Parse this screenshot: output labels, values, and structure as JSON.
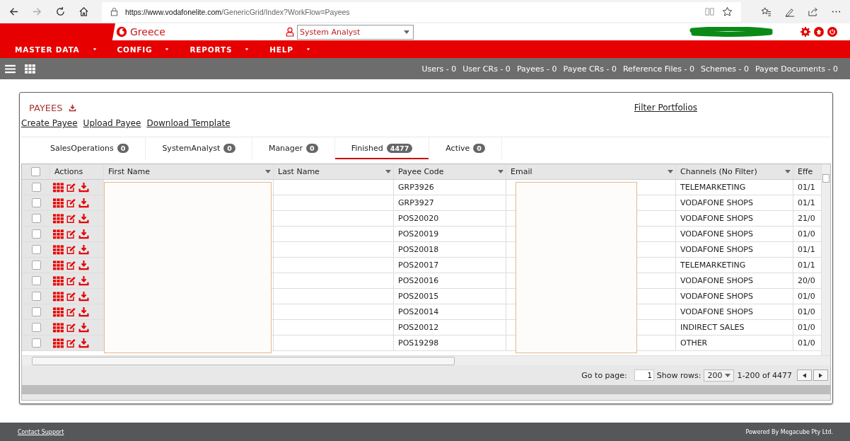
{
  "browser": {
    "url_host": "https://www.vodafonelite.com",
    "url_path": "/GenericGrid/Index?WorkFlow=Payees"
  },
  "header": {
    "brand": "Greece",
    "role": "System Analyst"
  },
  "nav": [
    "MASTER DATA",
    "CONFIG",
    "REPORTS",
    "HELP"
  ],
  "counters": [
    "Users - 0",
    "User CRs - 0",
    "Payees - 0",
    "Payee CRs - 0",
    "Reference Files - 0",
    "Schemes - 0",
    "Payee Documents - 0"
  ],
  "panel": {
    "title": "PAYEES",
    "filter_link": "Filter Portfolios",
    "links": [
      "Create Payee",
      "Upload Payee",
      "Download Template"
    ]
  },
  "tabs": [
    {
      "label": "SalesOperations",
      "count": "0",
      "selected": false
    },
    {
      "label": "SystemAnalyst",
      "count": "0",
      "selected": false
    },
    {
      "label": "Manager",
      "count": "0",
      "selected": false
    },
    {
      "label": "Finished",
      "count": "4477",
      "selected": true
    },
    {
      "label": "Active",
      "count": "0",
      "selected": false
    }
  ],
  "table": {
    "select_all_checked": false,
    "columns": [
      "Actions",
      "First Name",
      "Last Name",
      "Payee Code",
      "Email",
      "Channels (No Filter)",
      "Effe"
    ],
    "rows": [
      {
        "checked": false,
        "payee_code": "GRP3926",
        "channel": "TELEMARKETING",
        "column_7": "01/1"
      },
      {
        "checked": false,
        "payee_code": "GRP3927",
        "channel": "VODAFONE SHOPS",
        "column_7": "01/1"
      },
      {
        "checked": false,
        "payee_code": "POS20020",
        "channel": "VODAFONE SHOPS",
        "column_7": "21/0"
      },
      {
        "checked": false,
        "payee_code": "POS20019",
        "channel": "VODAFONE SHOPS",
        "column_7": "01/0"
      },
      {
        "checked": false,
        "payee_code": "POS20018",
        "channel": "VODAFONE SHOPS",
        "column_7": "01/1"
      },
      {
        "checked": false,
        "payee_code": "POS20017",
        "channel": "TELEMARKETING",
        "column_7": "01/1"
      },
      {
        "checked": false,
        "payee_code": "POS20016",
        "channel": "VODAFONE SHOPS",
        "column_7": "20/0"
      },
      {
        "checked": false,
        "payee_code": "POS20015",
        "channel": "VODAFONE SHOPS",
        "column_7": "01/0"
      },
      {
        "checked": false,
        "payee_code": "POS20014",
        "channel": "VODAFONE SHOPS",
        "column_7": "01/0"
      },
      {
        "checked": false,
        "payee_code": "POS20012",
        "channel": "INDIRECT SALES",
        "column_7": "01/0"
      },
      {
        "checked": false,
        "payee_code": "POS19298",
        "channel": "OTHER",
        "column_7": "01/0"
      }
    ]
  },
  "pager": {
    "goto_label": "Go to page:",
    "page": "1",
    "rows_label": "Show rows:",
    "rows": "200",
    "range": "1-200 of 4477"
  },
  "footer": {
    "support": "Contact Support",
    "powered": "Powered By Megacube Pty Ltd."
  }
}
